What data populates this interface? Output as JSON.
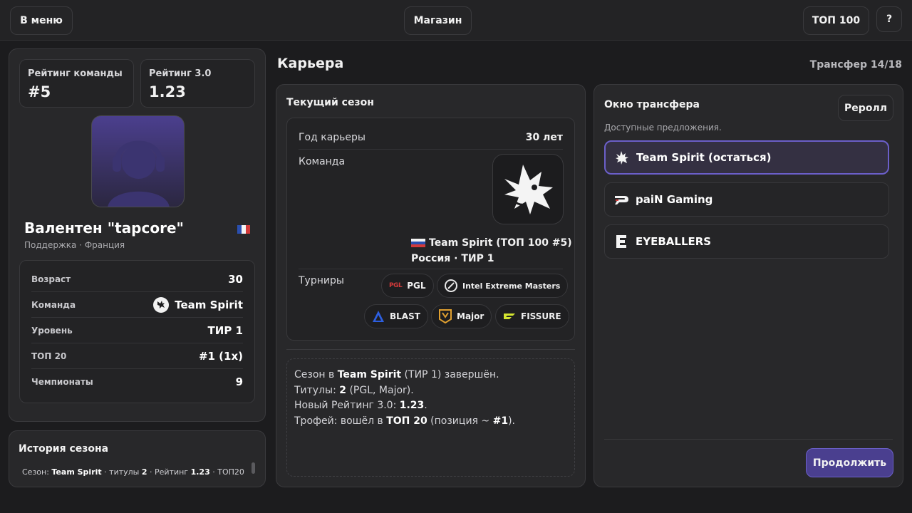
{
  "topbar": {
    "menu_label": "В меню",
    "shop_label": "Магазин",
    "top100_label": "ТОП 100",
    "help_label": "?"
  },
  "player": {
    "team_rating_label": "Рейтинг команды",
    "team_rating_value": "#5",
    "rating_label": "Рейтинг 3.0",
    "rating_value": "1.23",
    "name": "Валентен \"tapcore\"",
    "subtitle": "Поддержка · Франция",
    "flag": "france-flag-icon",
    "stats": [
      {
        "label": "Возраст",
        "value": "30"
      },
      {
        "label": "Команда",
        "value": "Team Spirit"
      },
      {
        "label": "Уровень",
        "value": "ТИР 1"
      },
      {
        "label": "ТОП 20",
        "value": "#1 (1x)"
      },
      {
        "label": "Чемпионаты",
        "value": "9"
      }
    ]
  },
  "history": {
    "title": "История сезона",
    "line_prefix": "Сезон: ",
    "line_team": "Team Spirit",
    "line_mid1": " · титулы ",
    "line_titles": "2",
    "line_mid2": " · Рейтинг ",
    "line_rating": "1.23",
    "line_suffix": " · ТОП20"
  },
  "career": {
    "title": "Карьера",
    "transfer_counter": "Трансфер 14/18",
    "season_title": "Текущий сезон",
    "year_label": "Год карьеры",
    "year_value": "30 лет",
    "team_label": "Команда",
    "team_line1": "Team Spirit (ТОП 100 #5)",
    "team_line2": "Россия · ТИР 1",
    "tournaments_label": "Турниры",
    "tournaments": [
      "PGL",
      "Intel Extreme Masters",
      "BLAST",
      "Major",
      "FISSURE"
    ],
    "summary": {
      "l1_prefix": "Сезон в ",
      "l1_team": "Team Spirit",
      "l1_suffix": " (ТИР 1) завершён.",
      "l2_prefix": "Титулы: ",
      "l2_bold": "2",
      "l2_suffix": " (PGL, Major).",
      "l3_prefix": "Новый Рейтинг 3.0: ",
      "l3_bold": "1.23",
      "l3_suffix": ".",
      "l4_prefix": "Трофей: вошёл в ",
      "l4_bold": "ТОП 20",
      "l4_mid": " (позиция ~ ",
      "l4_bold2": "#1",
      "l4_suffix": ")."
    }
  },
  "transfer": {
    "title": "Окно трансфера",
    "subtitle": "Доступные предложения.",
    "reroll_label": "Реролл",
    "offers": [
      "Team Spirit (остаться)",
      "paiN Gaming",
      "EYEBALLERS"
    ],
    "continue_label": "Продолжить"
  },
  "colors": {
    "accent": "#4a3f8f",
    "active_border": "#6b5fc9"
  }
}
